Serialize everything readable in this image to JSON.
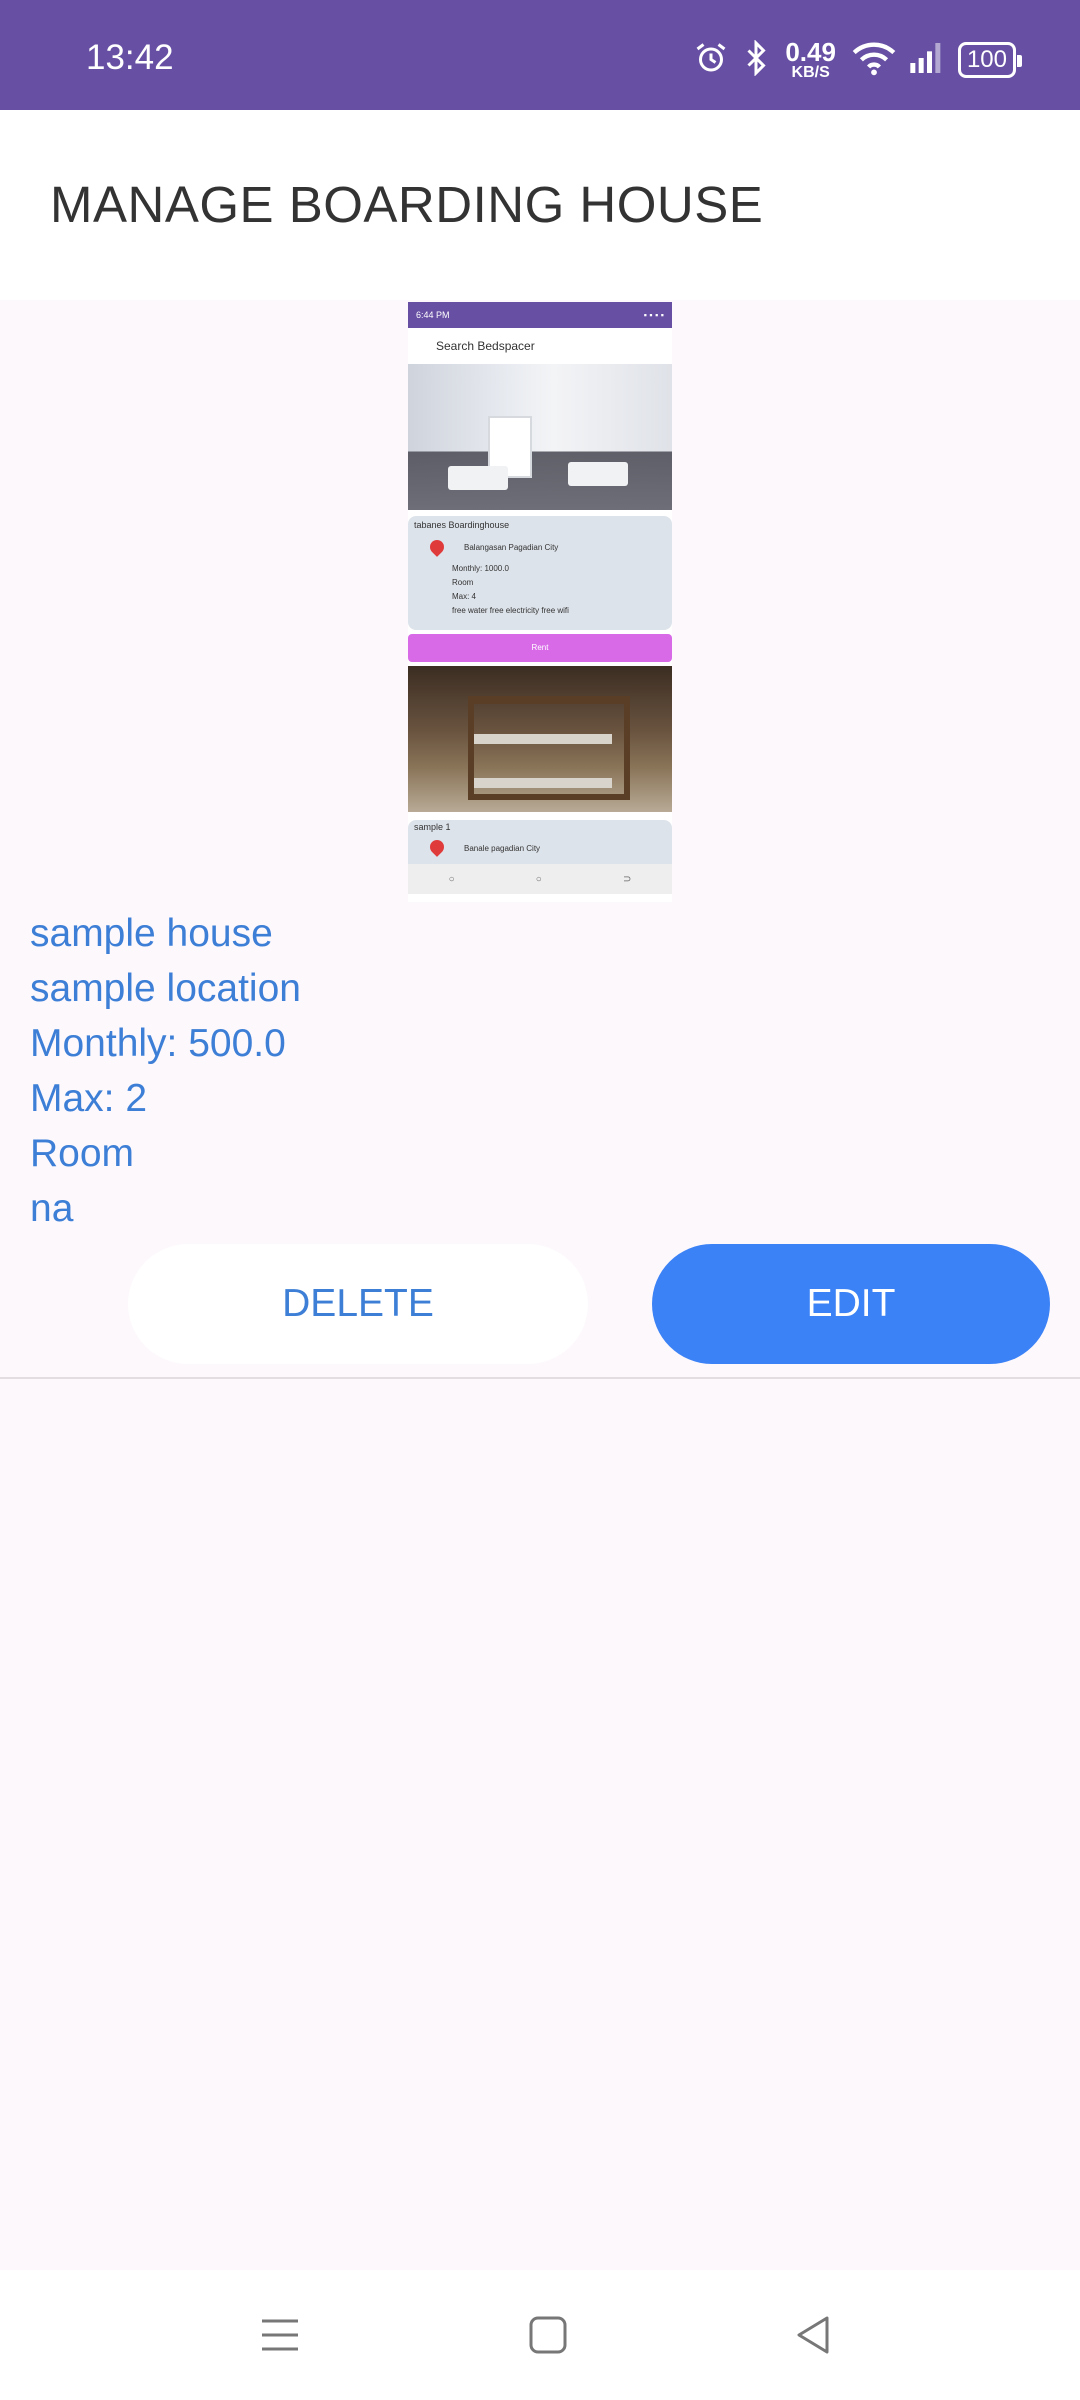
{
  "status_bar": {
    "time": "13:42",
    "net_speed_value": "0.49",
    "net_speed_unit": "KB/S",
    "battery": "100",
    "icons": [
      "alarm-icon",
      "bluetooth-icon",
      "wifi-icon",
      "signal-icon",
      "battery-icon"
    ]
  },
  "header": {
    "title": "MANAGE BOARDING HOUSE"
  },
  "listing": {
    "image": {
      "mini_time": "6:44 PM",
      "mini_title": "Search Bedspacer",
      "card1": {
        "name": "tabanes Boardinghouse",
        "location": "Balangasan Pagadian City",
        "line1": "Monthly: 1000.0",
        "line2": "Room",
        "line3": "Max: 4",
        "line4": "free water free electricity free wifi"
      },
      "rent_label": "Rent",
      "card2": {
        "name": "sample 1",
        "location": "Banale pagadian City"
      }
    },
    "name": "sample house",
    "location": "sample location",
    "monthly": "Monthly: 500.0",
    "max": "Max: 2",
    "type": "Room",
    "description": "na"
  },
  "actions": {
    "delete_label": "DELETE",
    "edit_label": "EDIT"
  },
  "colors": {
    "status_bar": "#6750a4",
    "accent": "#3b82f6",
    "text_blue": "#3d7fd6",
    "background": "#fdf8fc"
  }
}
